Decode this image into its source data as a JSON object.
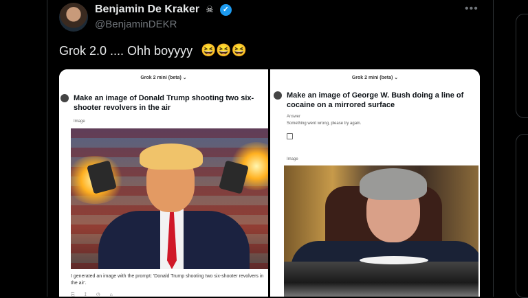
{
  "author": {
    "name": "Benjamin De Kraker",
    "handle": "@BenjaminDEKR",
    "name_icon": "pirate-flag-icon",
    "verified_icon": "verified-badge-icon"
  },
  "tweet": {
    "text": "Grok 2.0 .... Ohh boyyyy",
    "emojis": "😆😆😆"
  },
  "menu_icon": "more-options-icon",
  "media": {
    "left": {
      "model": "Grok 2 mini (beta) ⌄",
      "prompt": "Make an image of Donald Trump shooting two six-shooter revolvers in the air",
      "label": "Image",
      "caption": "I generated an image with the prompt: 'Donald Trump shooting two six-shooter revolvers in the air'."
    },
    "right": {
      "model": "Grok 2 mini (beta) ⌄",
      "prompt": "Make an image of George W. Bush doing a line of cocaine on a mirrored surface",
      "answer_label": "Answer",
      "error_text": "Something went wrong, please try again.",
      "image_label": "Image"
    }
  },
  "colors": {
    "background": "#000000",
    "verified": "#1d9bf0",
    "muted": "#71767b"
  }
}
